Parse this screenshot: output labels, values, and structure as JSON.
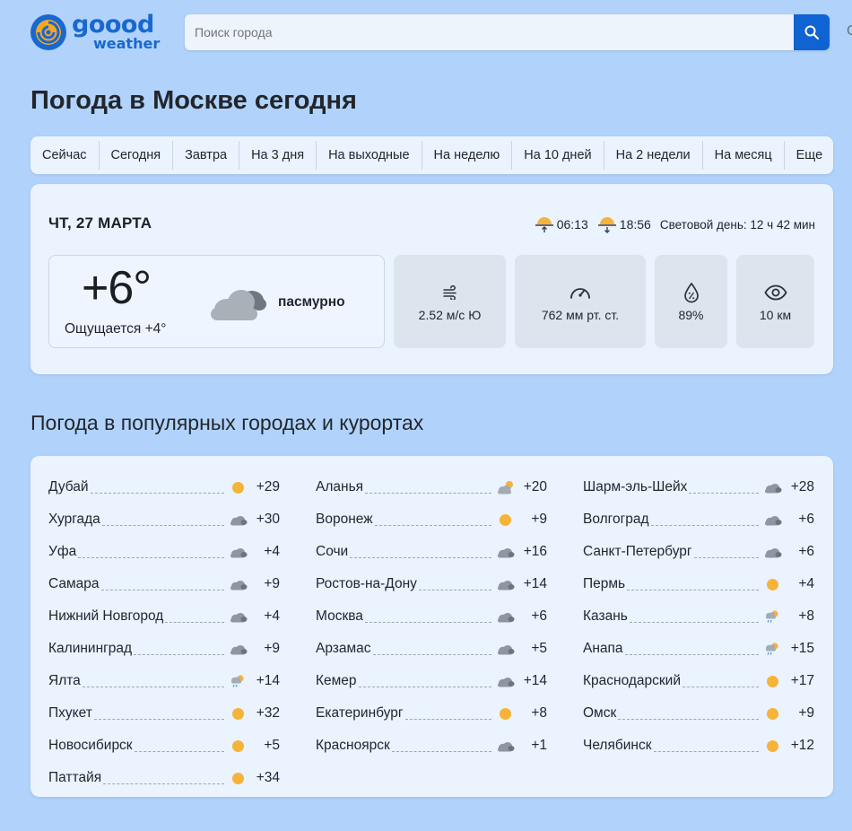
{
  "header": {
    "logo_line1": "goood",
    "logo_line2": "weather",
    "search_placeholder": "Поиск города",
    "extra_glyph": "С"
  },
  "page_title": "Погода в Москве сегодня",
  "tabs": [
    "Сейчас",
    "Сегодня",
    "Завтра",
    "На 3 дня",
    "На выходные",
    "На неделю",
    "На 10 дней",
    "На 2 недели",
    "На месяц",
    "Еще"
  ],
  "today": {
    "date": "ЧТ, 27 МАРТА",
    "sunrise": "06:13",
    "sunset": "18:56",
    "daylight": "Световой день: 12 ч 42 мин",
    "temp": "+6°",
    "feels_like": "Ощущается +4°",
    "condition": "пасмурно",
    "condition_icon": "cloud-icon",
    "wind": "2.52 м/с Ю",
    "pressure": "762 мм рт. ст.",
    "humidity": "89%",
    "visibility": "10 км"
  },
  "popular_title": "Погода в популярных городах и курортах",
  "colors": {
    "accent": "#0f63d2",
    "sun": "#f6b33a",
    "cloud": "#8e96a0",
    "background": "#b1d3fb",
    "card": "#eaf3fe"
  },
  "cities": {
    "col1": [
      {
        "name": "Дубай",
        "icon": "sun",
        "temp": "+29"
      },
      {
        "name": "Хургада",
        "icon": "cloud",
        "temp": "+30"
      },
      {
        "name": "Уфа",
        "icon": "cloud",
        "temp": "+4"
      },
      {
        "name": "Самара",
        "icon": "cloud",
        "temp": "+9"
      },
      {
        "name": "Нижний Новгород",
        "icon": "cloud",
        "temp": "+4"
      },
      {
        "name": "Калининград",
        "icon": "cloud",
        "temp": "+9"
      },
      {
        "name": "Ялта",
        "icon": "rain-sun",
        "temp": "+14"
      },
      {
        "name": "Пхукет",
        "icon": "sun",
        "temp": "+32"
      },
      {
        "name": "Новосибирск",
        "icon": "sun",
        "temp": "+5"
      },
      {
        "name": "Паттайя",
        "icon": "sun",
        "temp": "+34"
      }
    ],
    "col2": [
      {
        "name": "Аланья",
        "icon": "cloud-sun",
        "temp": "+20"
      },
      {
        "name": "Воронеж",
        "icon": "sun",
        "temp": "+9"
      },
      {
        "name": "Сочи",
        "icon": "cloud",
        "temp": "+16"
      },
      {
        "name": "Ростов-на-Дону",
        "icon": "cloud",
        "temp": "+14"
      },
      {
        "name": "Москва",
        "icon": "cloud",
        "temp": "+6"
      },
      {
        "name": "Арзамас",
        "icon": "cloud",
        "temp": "+5"
      },
      {
        "name": "Кемер",
        "icon": "cloud",
        "temp": "+14"
      },
      {
        "name": "Екатеринбург",
        "icon": "sun",
        "temp": "+8"
      },
      {
        "name": "Красноярск",
        "icon": "cloud",
        "temp": "+1"
      }
    ],
    "col3": [
      {
        "name": "Шарм-эль-Шейх",
        "icon": "cloud",
        "temp": "+28"
      },
      {
        "name": "Волгоград",
        "icon": "cloud",
        "temp": "+6"
      },
      {
        "name": "Санкт-Петербург",
        "icon": "cloud",
        "temp": "+6"
      },
      {
        "name": "Пермь",
        "icon": "sun",
        "temp": "+4"
      },
      {
        "name": "Казань",
        "icon": "rain-sun",
        "temp": "+8"
      },
      {
        "name": "Анапа",
        "icon": "rain-sun",
        "temp": "+15"
      },
      {
        "name": "Краснодарский",
        "icon": "sun",
        "temp": "+17"
      },
      {
        "name": "Омск",
        "icon": "sun",
        "temp": "+9"
      },
      {
        "name": "Челябинск",
        "icon": "sun",
        "temp": "+12"
      }
    ]
  }
}
